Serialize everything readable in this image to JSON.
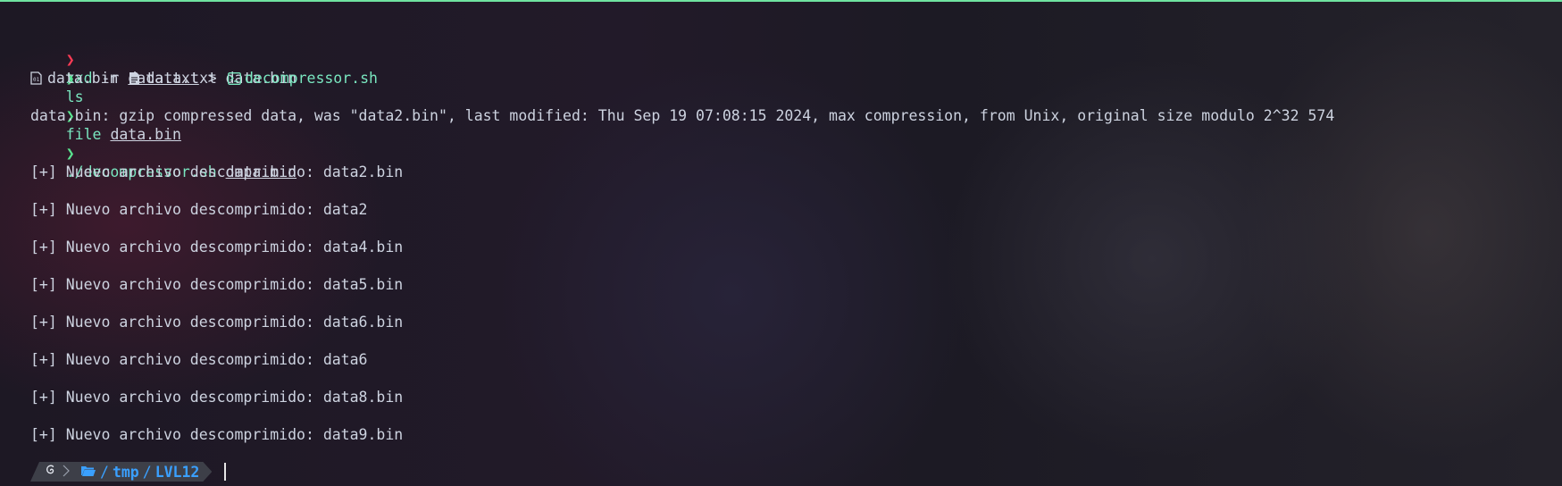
{
  "terminal": {
    "lines": {
      "l1": {
        "prompt": "❯",
        "cmd": "xxd",
        "args1": " -r ",
        "file": "data.txt",
        "args2": " > data.bin"
      },
      "l2": {
        "prompt": "❯",
        "cmd": "ls"
      },
      "l3": {
        "f1": "data.bin",
        "f2": "data.txt",
        "f3": "decompressor.sh"
      },
      "l4": {
        "prompt": "❯",
        "cmd": "file",
        "file": "data.bin"
      },
      "l5": {
        "text": "data.bin: gzip compressed data, was \"data2.bin\", last modified: Thu Sep 19 07:08:15 2024, max compression, from Unix, original size modulo 2^32 574"
      },
      "l6": {
        "prompt": "❯",
        "cmd": "./decompressor.sh",
        "file": "data.bin"
      }
    },
    "output": [
      "[+] Nuevo archivo descomprimido: data2.bin",
      "[+] Nuevo archivo descomprimido: data2",
      "[+] Nuevo archivo descomprimido: data4.bin",
      "[+] Nuevo archivo descomprimido: data5.bin",
      "[+] Nuevo archivo descomprimido: data6.bin",
      "[+] Nuevo archivo descomprimido: data6",
      "[+] Nuevo archivo descomprimido: data8.bin",
      "[+] Nuevo archivo descomprimido: data9.bin"
    ]
  },
  "statusbar": {
    "os_icon": "debian-icon",
    "folder_icon": "folder-open-icon",
    "path_sep1": "/",
    "path_tmp": "tmp",
    "path_sep2": "/",
    "path_dir": "LVL12"
  },
  "colors": {
    "prompt_ok": "#59e38f",
    "prompt_error": "#ff3b55",
    "command": "#79e6bf",
    "path": "#3aa0ff",
    "top_border": "#6fe3a0"
  }
}
